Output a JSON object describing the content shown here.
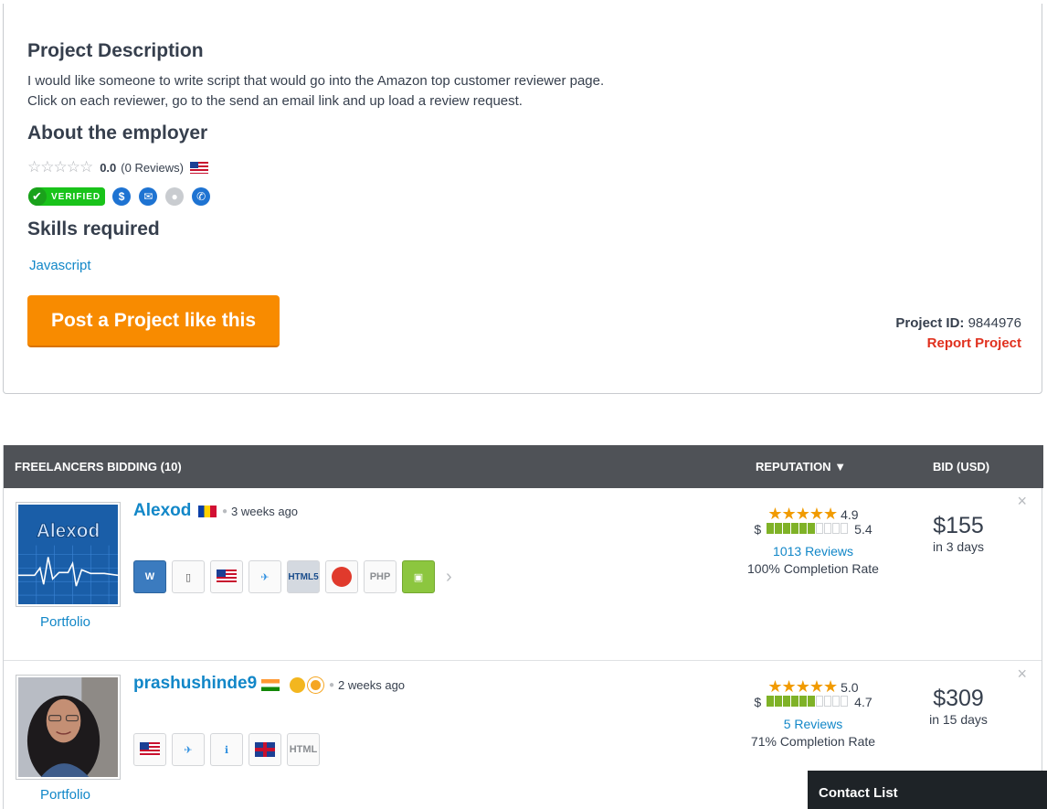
{
  "project": {
    "description_heading": "Project Description",
    "description_lines": [
      "I would like someone to write script that would go into the Amazon top customer reviewer page.",
      "Click on each reviewer, go to the send an email link and up load a review request."
    ],
    "employer_heading": "About the employer",
    "employer_score": "0.0",
    "employer_reviews": "(0 Reviews)",
    "verified_label": "VERIFIED",
    "skills_heading": "Skills required",
    "skills": [
      "Javascript"
    ],
    "post_button": "Post a Project like this",
    "project_id_label": "Project ID:",
    "project_id": "9844976",
    "report_link": "Report Project"
  },
  "bids_table": {
    "headers": {
      "freelancers": "FREELANCERS BIDDING (10)",
      "reputation": "REPUTATION",
      "bid": "BID (USD)"
    },
    "rows": [
      {
        "username": "Alexod",
        "posted": "3 weeks ago",
        "avatar_text": "Alexod",
        "portfolio": "Portfolio",
        "rating": "4.9",
        "earnings_score": "5.4",
        "earnings_bars_on": 6,
        "reviews": "1013 Reviews",
        "completion": "100% Completion Rate",
        "bid_amount": "$155",
        "bid_days": "in 3 days",
        "badges": [
          "wordpress-icon",
          "mobile-icon",
          "us-flag-icon",
          "prepaid-icon",
          "html5-icon",
          "red-badge-icon",
          "php-icon",
          "android-icon"
        ]
      },
      {
        "username": "prashushinde9",
        "posted": "2 weeks ago",
        "portfolio": "Portfolio",
        "rating": "5.0",
        "earnings_score": "4.7",
        "earnings_bars_on": 6,
        "reviews": "5 Reviews",
        "completion": "71% Completion Rate",
        "bid_amount": "$309",
        "bid_days": "in 15 days",
        "badges": [
          "us-flag-icon",
          "prepaid-icon",
          "preferred-icon",
          "uk-flag-icon",
          "html-icon"
        ]
      }
    ],
    "dollar_sign": "$",
    "close_symbol": "×"
  },
  "contact_list": {
    "label": "Contact List"
  },
  "colors": {
    "link": "#1287c8",
    "cta": "#f88b00",
    "report": "#e0301e",
    "header_bg": "#4f5257",
    "star": "#f19b00",
    "verified": "#19c31a"
  }
}
